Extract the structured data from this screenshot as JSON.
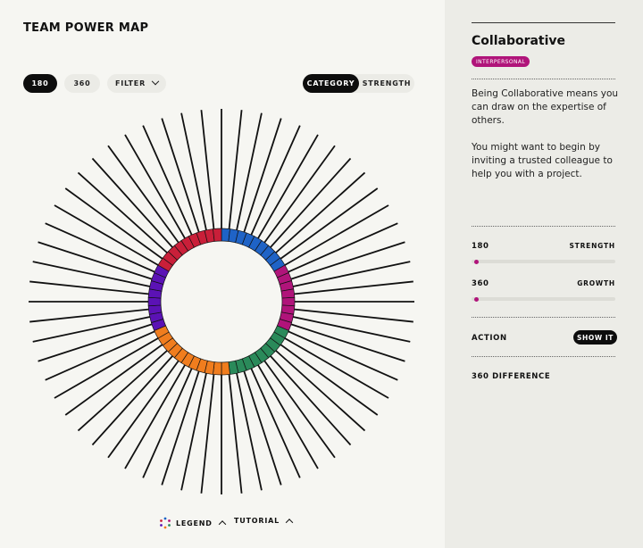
{
  "header": {
    "title": "TEAM POWER MAP"
  },
  "controls": {
    "view_180": "180",
    "view_360": "360",
    "filter": "FILTER",
    "category": "CATEGORY",
    "strength": "STRENGTH"
  },
  "footer": {
    "legend": "LEGEND",
    "tutorial": "TUTORIAL"
  },
  "radial_map": {
    "spoke_count": 60,
    "ring_segments": [
      {
        "color": "#1f63c6",
        "count": 9
      },
      {
        "color": "#b0147a",
        "count": 8
      },
      {
        "color": "#2a8a5a",
        "count": 9
      },
      {
        "color": "#f07d1e",
        "count": 11
      },
      {
        "color": "#5b12b5",
        "count": 8
      },
      {
        "color": "#c91f39",
        "count": 9
      }
    ]
  },
  "panel": {
    "trait_name": "Collaborative",
    "category_badge": "INTERPERSONAL",
    "description_1": "Being Collaborative means you can draw on the expertise of others.",
    "description_2": "You might want to begin by inviting a trusted colleague to help you with a project.",
    "score_180_label": "180",
    "score_180_type": "STRENGTH",
    "score_180_level": 0.02,
    "score_360_label": "360",
    "score_360_type": "GROWTH",
    "score_360_level": 0.02,
    "action_label": "ACTION",
    "show_it": "SHOW IT",
    "difference_label": "360 DIFFERENCE"
  },
  "colors": {
    "accent": "#b0147a",
    "dark": "#0d0d0d"
  }
}
